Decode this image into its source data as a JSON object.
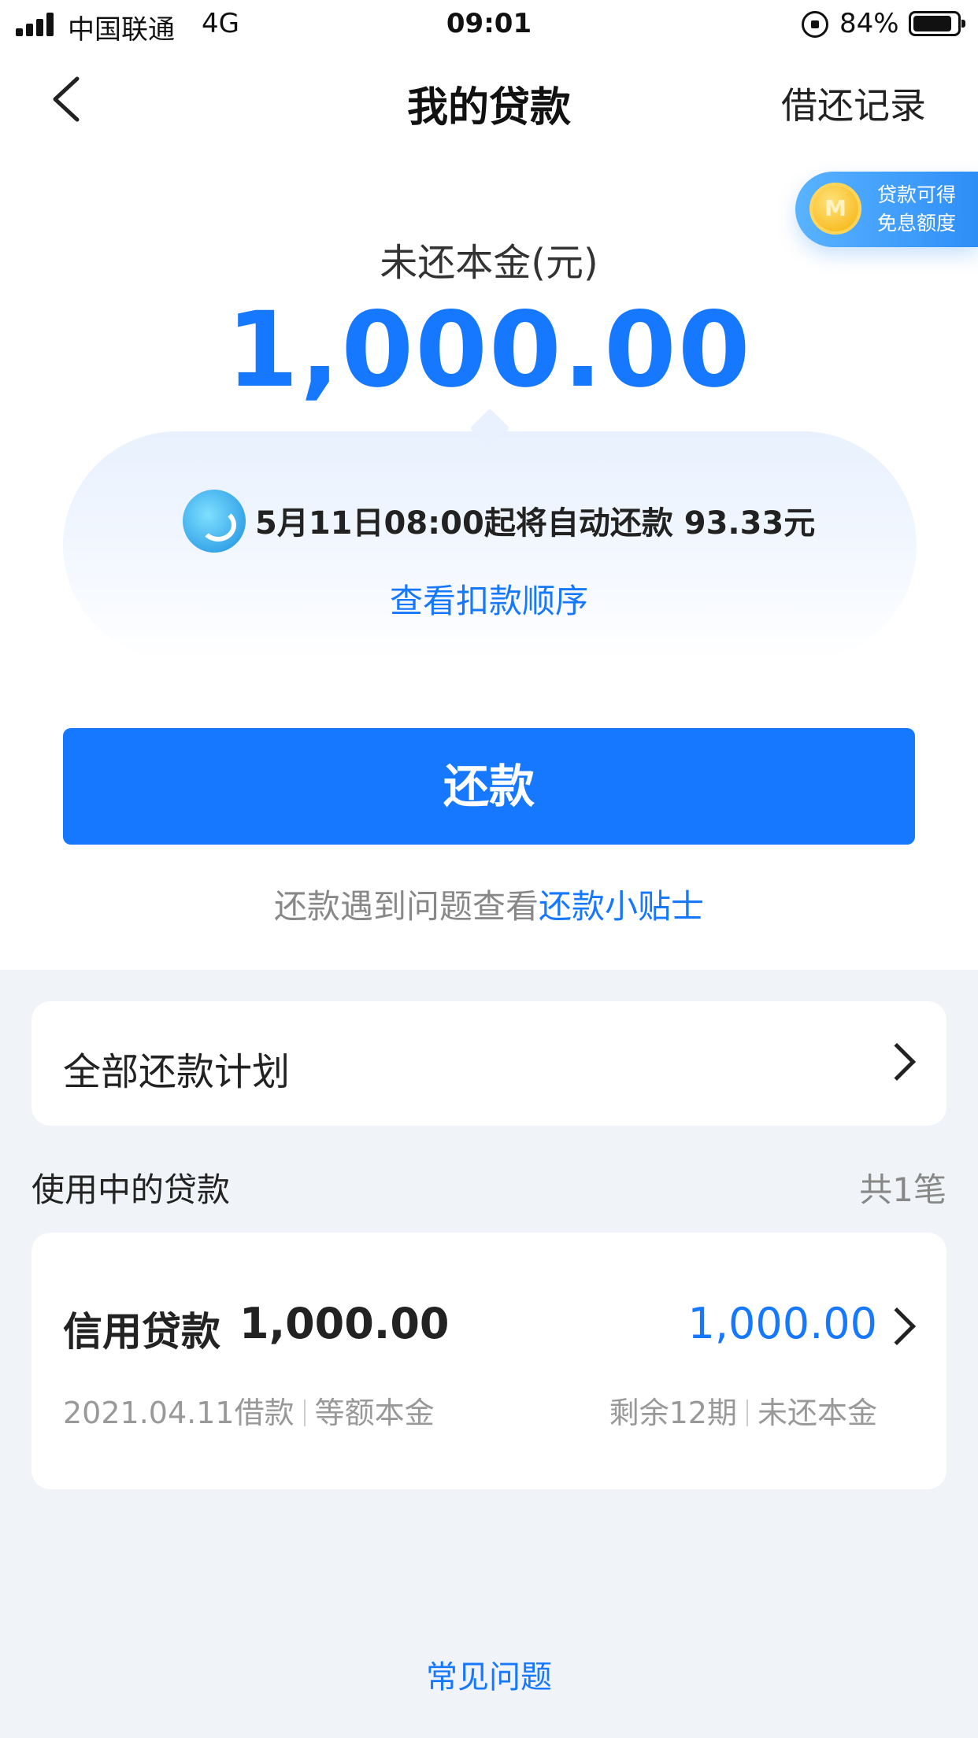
{
  "status_bar": {
    "carrier": "中国联通",
    "network": "4G",
    "time": "09:01",
    "battery": "84%"
  },
  "nav": {
    "title": "我的贷款",
    "right_link": "借还记录"
  },
  "promo": {
    "line1": "贷款可得",
    "line2": "免息额度"
  },
  "balance": {
    "label": "未还本金(元)",
    "value": "1,000.00"
  },
  "notice": {
    "text": "5月11日08:00起将自动还款 93.33元",
    "link": "查看扣款顺序"
  },
  "repay_button": "还款",
  "tips": {
    "prefix": "还款遇到问题查看",
    "link": "还款小贴士"
  },
  "plan": {
    "label": "全部还款计划"
  },
  "active_loans": {
    "title": "使用中的贷款",
    "count": "共1笔",
    "items": [
      {
        "name": "信用贷款",
        "amount": "1,000.00",
        "remaining": "1,000.00",
        "date": "2021.04.11借款",
        "method": "等额本金",
        "periods": "剩余12期",
        "remaining_label": "未还本金"
      }
    ]
  },
  "faq": "常见问题",
  "colors": {
    "accent": "#1677ff",
    "background": "#f0f4f9"
  }
}
